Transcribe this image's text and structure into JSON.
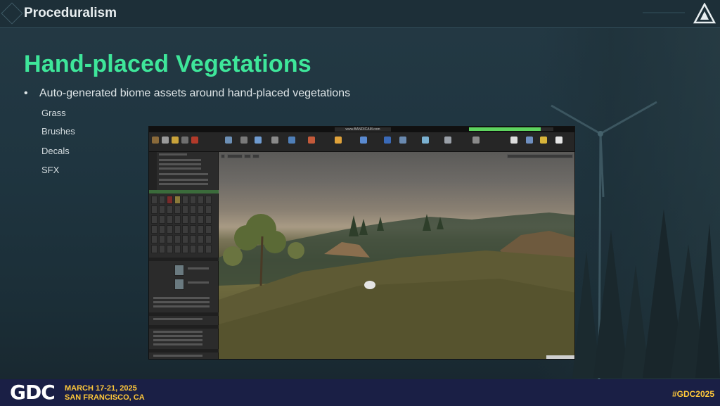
{
  "header": {
    "title": "Proceduralism"
  },
  "slide": {
    "heading": "Hand-placed Vegetations",
    "bullet": "Auto-generated biome assets around hand-placed vegetations",
    "sub_items": [
      "Grass",
      "Brushes",
      "Decals",
      "SFX"
    ]
  },
  "screenshot": {
    "recorder_label": "www.BANDICAM.com",
    "progress": 0.85
  },
  "footer": {
    "dates": "MARCH 17-21, 2025",
    "location": "SAN FRANCISCO, CA",
    "hashtag": "#GDC2025",
    "brand": "GDC"
  },
  "colors": {
    "heading": "#3ee69a",
    "accent": "#ffc83a",
    "footer_bg": "#1a1f45"
  }
}
